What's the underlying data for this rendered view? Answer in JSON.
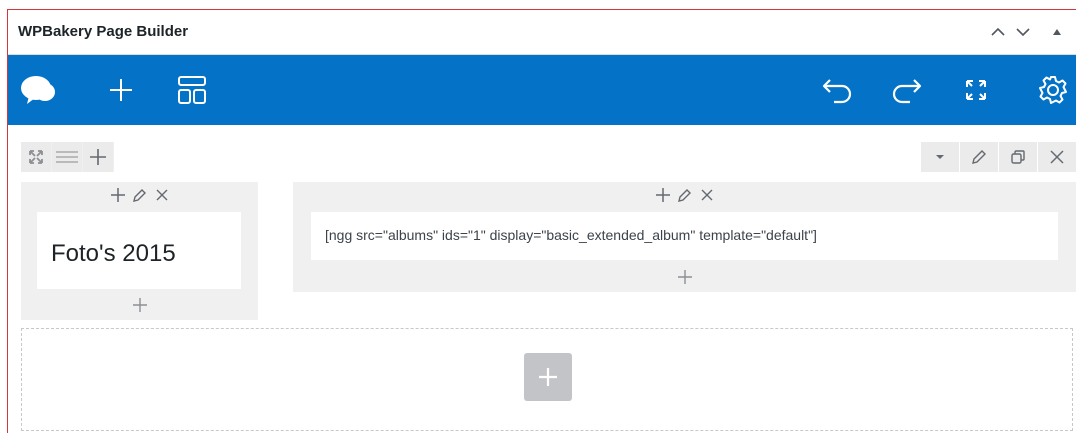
{
  "panel": {
    "title": "WPBakery Page Builder"
  },
  "toolbar": {
    "color": "#0473c7",
    "left_icons": [
      "logo-cloud-icon",
      "add-element-icon",
      "templates-icon"
    ],
    "right_icons": [
      "undo-icon",
      "redo-icon",
      "fullscreen-icon",
      "settings-gear-icon"
    ]
  },
  "row": {
    "left_controls": [
      "move-icon",
      "layout-icon",
      "add-column-icon"
    ],
    "right_controls": [
      "toggle-caret-icon",
      "edit-pencil-icon",
      "clone-icon",
      "delete-x-icon"
    ],
    "columns": [
      {
        "element_type": "heading",
        "text": "Foto's 2015"
      },
      {
        "element_type": "shortcode",
        "text": "[ngg src=\"albums\" ids=\"1\" display=\"basic_extended_album\" template=\"default\"]"
      }
    ]
  },
  "empty_row": {
    "add_icon": "add-element-plus-icon"
  }
}
